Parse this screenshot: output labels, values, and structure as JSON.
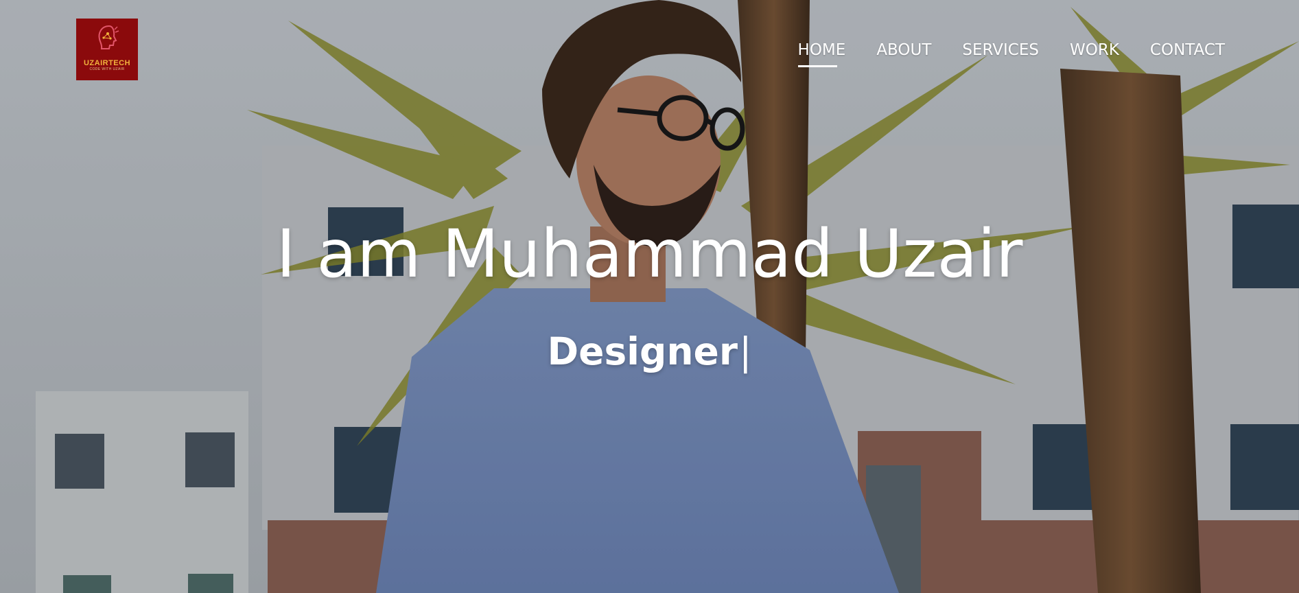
{
  "logo": {
    "name": "UZAIRTECH",
    "tagline": "CODE WITH UZAIR",
    "background": "#8b0a0c",
    "text_color": "#f1b23c"
  },
  "nav": {
    "items": [
      {
        "label": "HOME",
        "active": true
      },
      {
        "label": "ABOUT",
        "active": false
      },
      {
        "label": "SERVICES",
        "active": false
      },
      {
        "label": "WORK",
        "active": false
      },
      {
        "label": "CONTACT",
        "active": false
      }
    ]
  },
  "hero": {
    "headline": "I am Muhammad Uzair",
    "subtitle": "Designer",
    "cursor": "|"
  }
}
